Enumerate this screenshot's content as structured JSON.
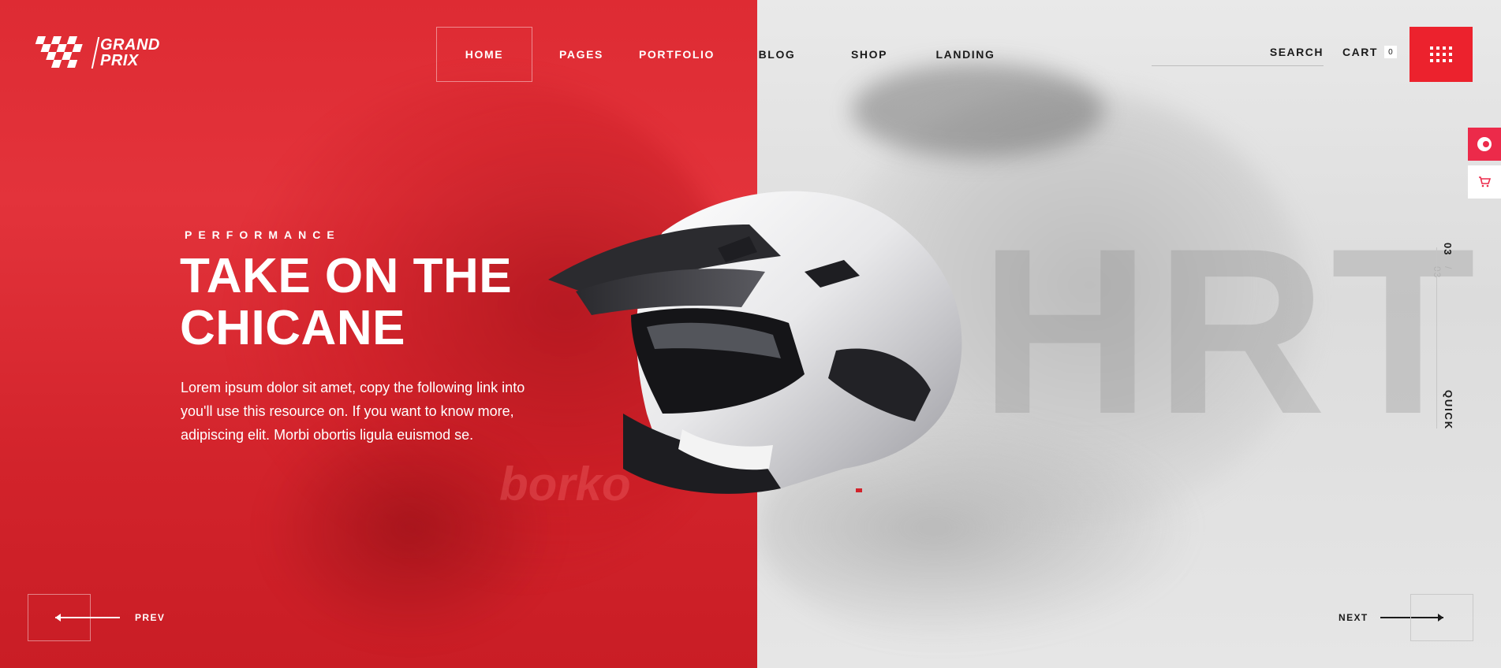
{
  "brand": {
    "name_line1": "GRAND",
    "name_line2": "PRIX",
    "logo_icon": "checkered-flag-icon"
  },
  "nav": {
    "items": [
      {
        "label": "HOME",
        "active": true
      },
      {
        "label": "PAGES",
        "active": false
      },
      {
        "label": "PORTFOLIO",
        "active": false
      },
      {
        "label": "BLOG",
        "active": false
      },
      {
        "label": "SHOP",
        "active": false
      },
      {
        "label": "LANDING",
        "active": false
      }
    ]
  },
  "header": {
    "search_label": "SEARCH",
    "cart_label": "CART",
    "cart_count": "0",
    "menu_icon": "grid-dots-icon"
  },
  "side": {
    "widget_a_icon": "record-icon",
    "widget_b_icon": "cart-icon",
    "slide_current": "03",
    "slide_total": "/ 03",
    "quick_label": "QUICK"
  },
  "hero": {
    "kicker": "PERFORMANCE",
    "title_line1": "TAKE ON THE",
    "title_line2": "CHICANE",
    "text": "Lorem ipsum dolor sit amet, copy the following link into you'll use this resource on. If you want to know more, adipiscing elit. Morbi obortis ligula euismod se.",
    "background_word": "HRT",
    "ghost_brand": "borko"
  },
  "pager": {
    "prev_label": "PREV",
    "next_label": "NEXT"
  },
  "colors": {
    "accent": "#ec222d",
    "left_panel": "#dc2a31",
    "right_panel": "#e2e2e2",
    "dark_text": "#1b1b1b"
  }
}
